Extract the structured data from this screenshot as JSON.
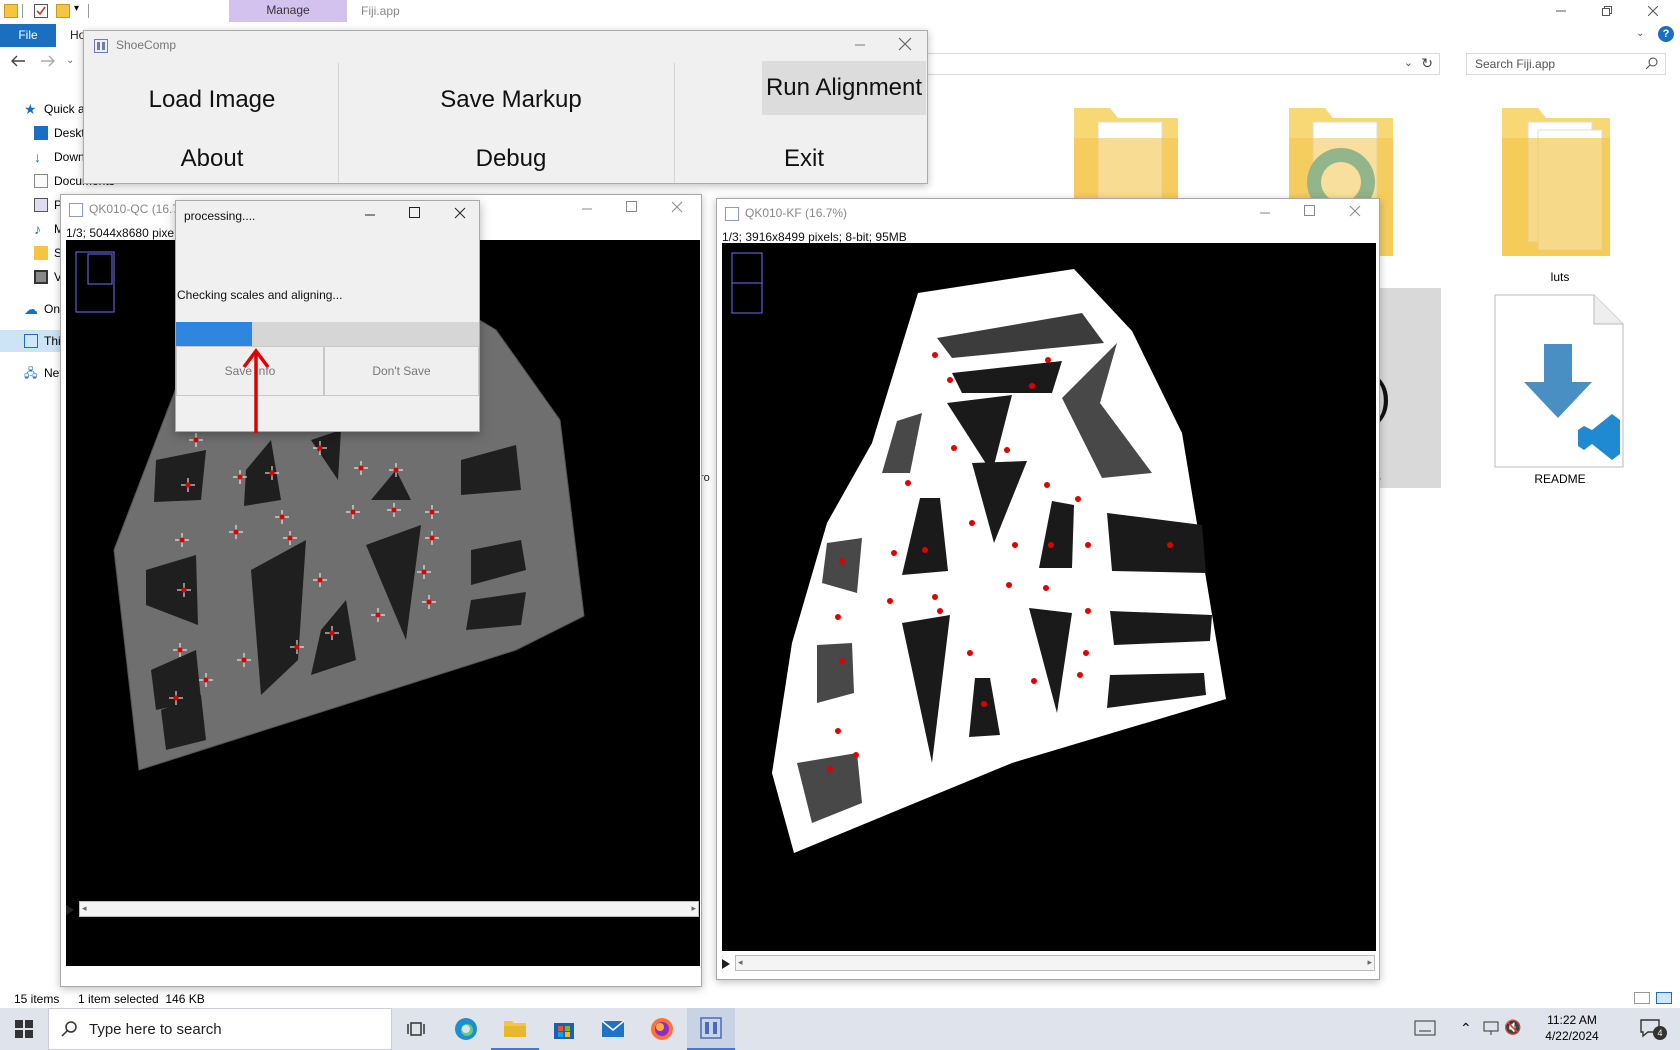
{
  "explorer": {
    "context_tab": "Manage",
    "window_title": "Fiji.app",
    "file_tab": "File",
    "home_tab_partial": "Ho",
    "search_placeholder": "Search Fiji.app",
    "nav_items": [
      "Quick a",
      "Deskto",
      "Down",
      "Documents",
      "Pi",
      "M",
      "Sc",
      "Vi",
      "On",
      "Thi",
      "Net"
    ],
    "folders": [
      {
        "label": "luts"
      },
      {
        "label": "README"
      }
    ],
    "partial_labels": [
      "rs",
      "ro",
      "4"
    ],
    "status_count": "15 items",
    "status_selected": "1 item selected  146 KB"
  },
  "shoecomp": {
    "title": "ShoeComp",
    "buttons": [
      "Load Image",
      "Save Markup",
      "Run Alignment",
      "About",
      "Debug",
      "Exit"
    ]
  },
  "left_image": {
    "title": "QK010-QC (16.7",
    "info": "1/3; 5044x8680 pixe"
  },
  "right_image": {
    "title": "QK010-KF (16.7%)",
    "info": "1/3; 3916x8499 pixels; 8-bit; 95MB"
  },
  "dialog": {
    "title": "processing....",
    "message": "Checking scales and aligning...",
    "progress_fraction": 0.25,
    "save_button": "Save Info",
    "dont_save_button": "Don't Save"
  },
  "taskbar": {
    "search_placeholder": "Type here to search",
    "time": "11:22 AM",
    "date": "4/22/2024",
    "notification_count": "4"
  },
  "colors": {
    "accent": "#1a6fc1",
    "progress": "#2f86de",
    "annotation_red": "#e00000",
    "context_tab": "#d4c2ee"
  }
}
